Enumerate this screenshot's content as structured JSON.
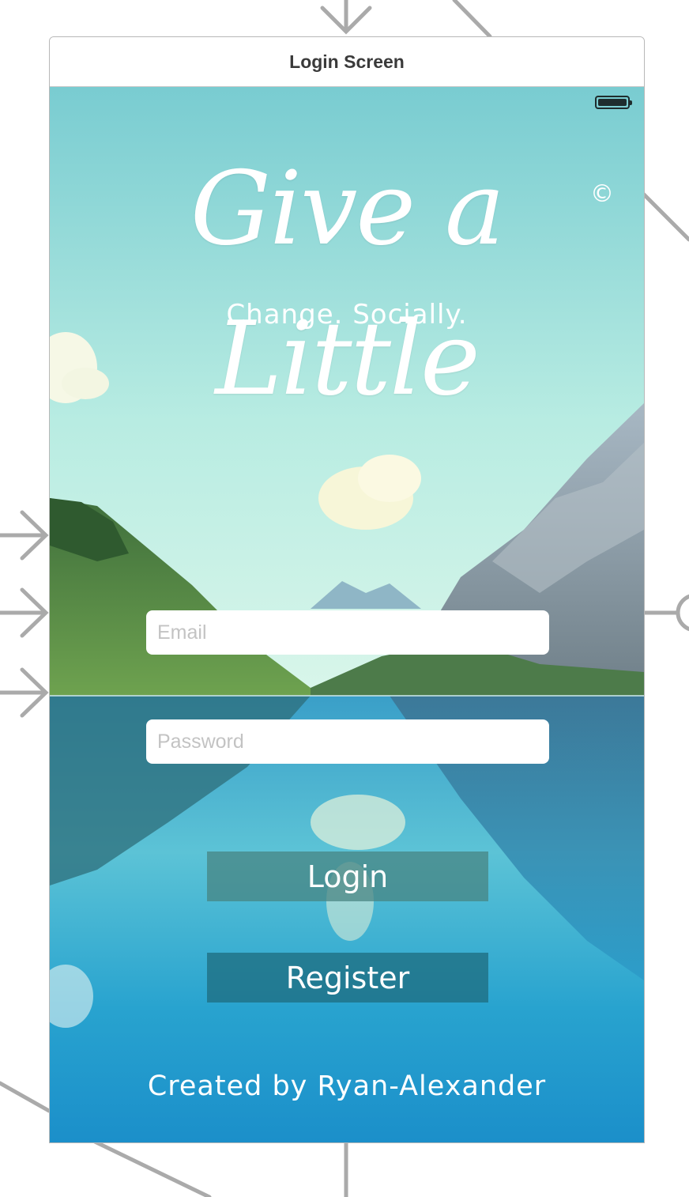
{
  "scene": {
    "title": "Login Screen"
  },
  "app": {
    "logo": "Give a Little",
    "copyright": "©",
    "tagline": "Change. Socially.",
    "credit": "Created by Ryan-Alexander"
  },
  "form": {
    "email_placeholder": "Email",
    "password_placeholder": "Password",
    "login_label": "Login",
    "register_label": "Register"
  },
  "colors": {
    "sky_top": "#7ed0d3",
    "water": "#2aa7cf",
    "login_button": "#46827f",
    "register_button": "#1f6e82"
  },
  "icons": {
    "battery": "battery-icon",
    "segue": "segue-arrow-icon"
  }
}
